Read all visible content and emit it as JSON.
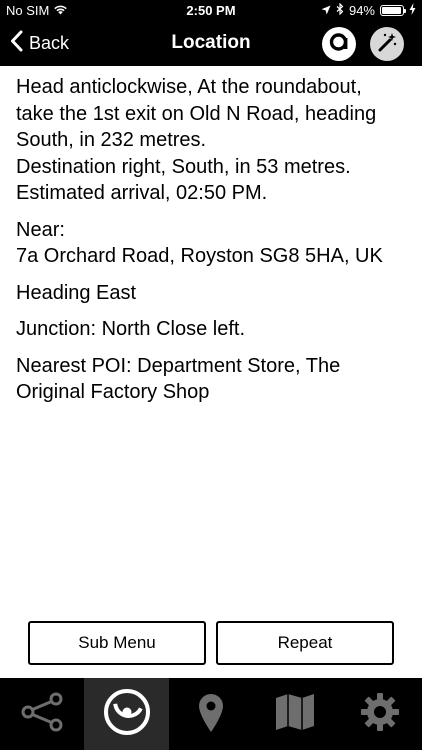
{
  "status_bar": {
    "carrier": "No SIM",
    "time": "2:50 PM",
    "battery": "94%",
    "battery_level": 0.94
  },
  "nav": {
    "back_label": "Back",
    "title": "Location"
  },
  "content": {
    "directions": [
      "Head anticlockwise, At the roundabout,",
      "take the 1st exit on Old N Road, heading",
      "South, in 232 metres.",
      "Destination right, South, in 53 metres.",
      "Estimated arrival, 02:50 PM."
    ],
    "near_label": "Near:",
    "near_address": "7a Orchard Road, Royston SG8 5HA, UK",
    "heading": "Heading East",
    "junction": "Junction: North Close left.",
    "poi_line1": "Nearest POI: Department Store, The",
    "poi_line2": "Original Factory Shop"
  },
  "buttons": {
    "sub_menu": "Sub Menu",
    "repeat": "Repeat"
  },
  "tabs": [
    {
      "icon": "route-icon",
      "active": false
    },
    {
      "icon": "location-radar-icon",
      "active": true
    },
    {
      "icon": "map-pin-icon",
      "active": false
    },
    {
      "icon": "map-icon",
      "active": false
    },
    {
      "icon": "gear-icon",
      "active": false
    }
  ],
  "colors": {
    "bar_background": "#000000",
    "active_tab": "#2a2a2a",
    "inactive_icon": "#6e6e6e"
  }
}
